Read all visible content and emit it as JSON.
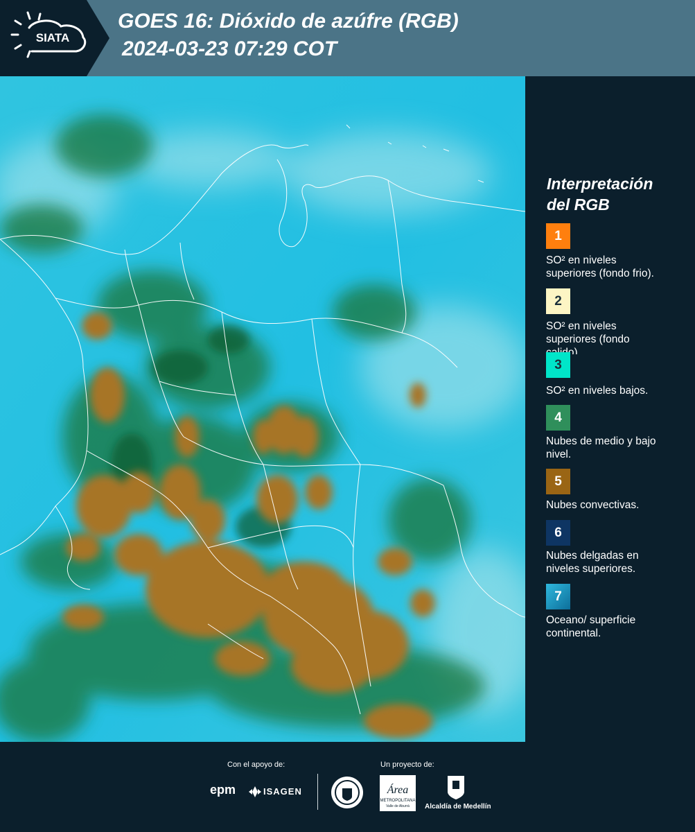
{
  "header": {
    "logo_text": "SIATA",
    "title_line1": "GOES 16: Dióxido de azúfre (RGB)",
    "title_line2": "2024-03-23 07:29 COT"
  },
  "legend": {
    "title_line1": "Interpretación",
    "title_line2": "del RGB",
    "items": [
      {
        "number": "1",
        "color": "#ff7f0e",
        "text_lines": [
          "SO² en niveles",
          "superiores (fondo frio)."
        ]
      },
      {
        "number": "2",
        "color": "#fdf5c4",
        "text_lines": [
          "SO² en niveles",
          "superiores (fondo",
          "calido)."
        ]
      },
      {
        "number": "3",
        "color": "#00e5c9",
        "text_lines": [
          "SO² en niveles bajos."
        ]
      },
      {
        "number": "4",
        "color": "#2f8f5b",
        "text_lines": [
          "Nubes de medio y bajo",
          "nivel."
        ]
      },
      {
        "number": "5",
        "color": "#9a6514",
        "text_lines": [
          "Nubes convectivas."
        ]
      },
      {
        "number": "6",
        "color": "#0e3563",
        "text_lines": [
          "Nubes delgadas en",
          "niveles superiores."
        ]
      },
      {
        "number": "7",
        "color": "#1a97c4",
        "text_lines": [
          "Oceano/ superficie",
          "continental."
        ]
      }
    ]
  },
  "footer": {
    "support_label": "Con el apoyo de:",
    "project_label": "Un proyecto de:",
    "epm_text": "epm",
    "isagen_text": "ISAGEN",
    "area_text": "Área",
    "area_sub1": "METROPOLITANA",
    "area_sub2": "Valle de Aburrá",
    "alcaldia_text": "Alcaldía de Medellín"
  },
  "colors": {
    "header_bg": "#4b7487",
    "panel_bg": "#0b1f2c",
    "sky_cyan": "#26c6e4",
    "cloud_green": "#1f6e3b",
    "convective_brown": "#a57428"
  }
}
